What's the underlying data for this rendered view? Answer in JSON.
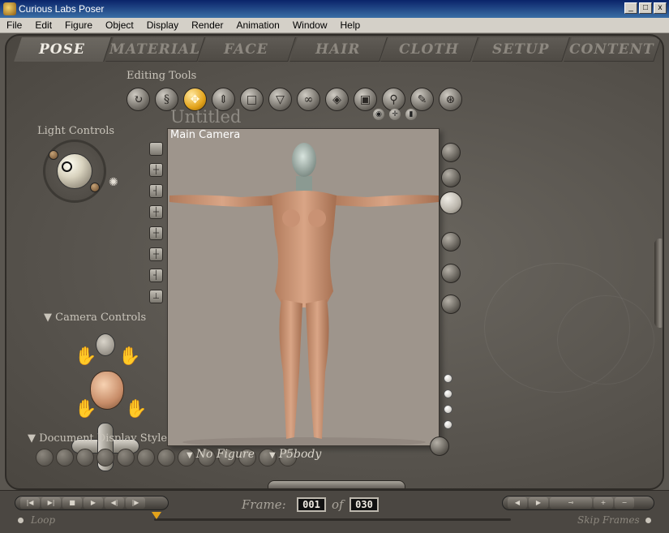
{
  "window": {
    "title": "Curious Labs Poser",
    "buttons": [
      "_",
      "□",
      "x"
    ]
  },
  "menu": [
    "File",
    "Edit",
    "Figure",
    "Object",
    "Display",
    "Render",
    "Animation",
    "Window",
    "Help"
  ],
  "tabs": [
    {
      "label": "POSE",
      "active": true
    },
    {
      "label": "MATERIAL",
      "active": false
    },
    {
      "label": "FACE",
      "active": false
    },
    {
      "label": "HAIR",
      "active": false
    },
    {
      "label": "CLOTH",
      "active": false
    },
    {
      "label": "SETUP",
      "active": false
    },
    {
      "label": "CONTENT",
      "active": false
    }
  ],
  "editing_tools": {
    "label": "Editing Tools",
    "tools": [
      {
        "name": "rotate-tool",
        "glyph": "↻"
      },
      {
        "name": "twist-tool",
        "glyph": "§"
      },
      {
        "name": "translate-tool",
        "glyph": "✥",
        "active": true
      },
      {
        "name": "translate-in-out-tool",
        "glyph": "⇕"
      },
      {
        "name": "scale-tool",
        "glyph": "□"
      },
      {
        "name": "taper-tool",
        "glyph": "▽"
      },
      {
        "name": "chain-break-tool",
        "glyph": "∞"
      },
      {
        "name": "color-tool",
        "glyph": "◈"
      },
      {
        "name": "grouping-tool",
        "glyph": "▣"
      },
      {
        "name": "view-magnifier-tool",
        "glyph": "⚲"
      },
      {
        "name": "morphing-tool",
        "glyph": "✎"
      },
      {
        "name": "direct-manipulation-tool",
        "glyph": "⊛"
      }
    ]
  },
  "light_controls": {
    "label": "Light Controls"
  },
  "camera_controls": {
    "label": "Camera Controls"
  },
  "document": {
    "title": "Untitled",
    "camera_label": "Main Camera"
  },
  "document_display_style": {
    "label": "Document Display Style"
  },
  "selectors": {
    "figure": "No Figure",
    "actor": "P5body"
  },
  "animation": {
    "frame_label": "Frame:",
    "current_frame": "001",
    "of_label": "of",
    "total_frames": "030",
    "loop_label": "Loop",
    "skip_frames_label": "Skip Frames",
    "playback_buttons": [
      "|◀",
      "▶|",
      "■",
      "▶",
      "◀|",
      "|▶"
    ],
    "key_buttons": [
      "◀",
      "▶",
      "⊸",
      "+",
      "−"
    ]
  },
  "colors": {
    "accent": "#e3a31a",
    "workspace": "#5a5650",
    "viewport_bg": "#9e958c"
  }
}
